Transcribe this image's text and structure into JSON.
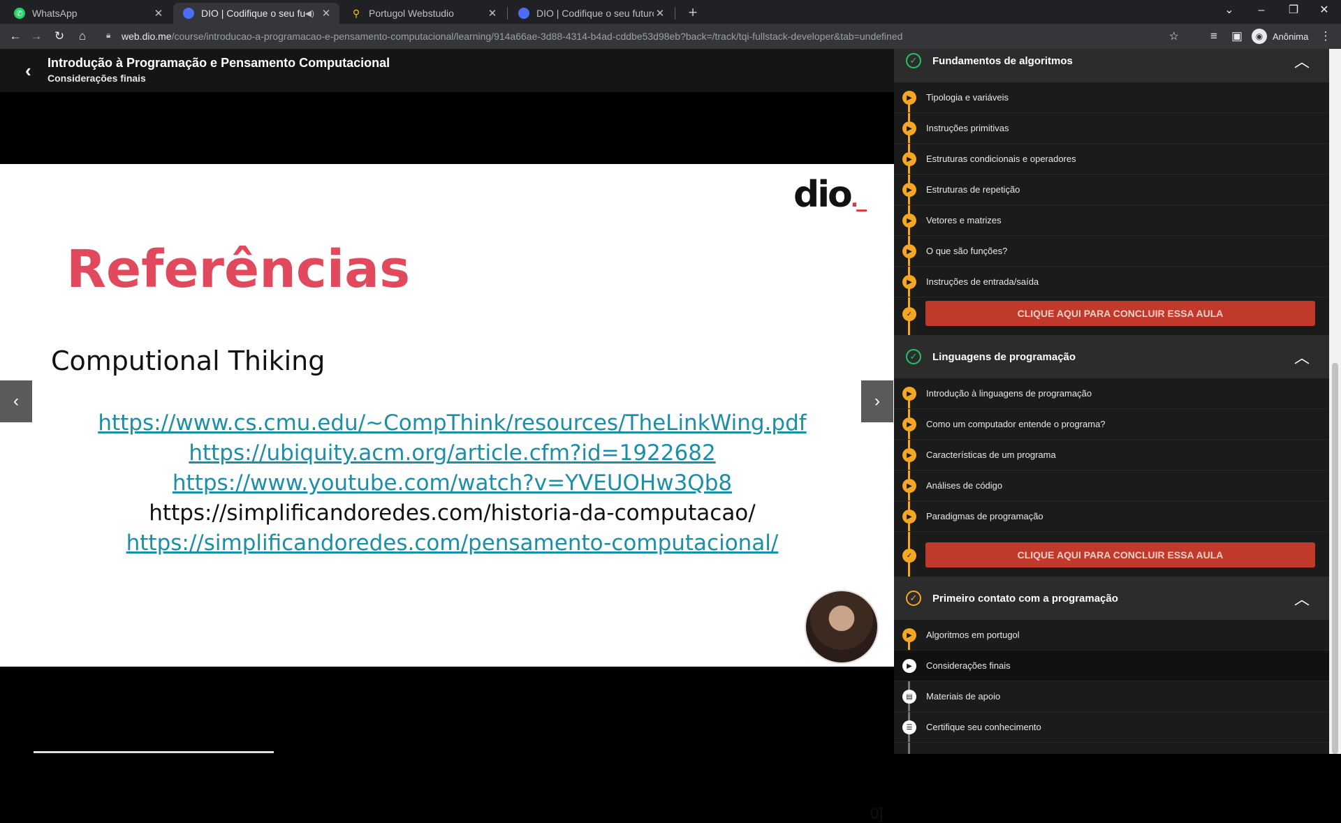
{
  "browser": {
    "tabs": [
      {
        "title": "WhatsApp",
        "favicon": "whatsapp-icon",
        "color": "#25d366"
      },
      {
        "title": "DIO | Codifique o seu futuro",
        "favicon": "dio-icon",
        "color": "#4e6cf5",
        "muted_icon": "speaker-icon"
      },
      {
        "title": "Portugol Webstudio",
        "favicon": "pin-icon",
        "color": "#f5c518"
      },
      {
        "title": "DIO | Codifique o seu futuro glol",
        "favicon": "dio-icon",
        "color": "#4e6cf5"
      }
    ],
    "url_host": "web.dio.me",
    "url_path": "/course/introducao-a-programacao-e-pensamento-computacional/learning/914a66ae-3d88-4314-b4ad-cddbe53d98eb?back=/track/tqi-fullstack-developer&tab=undefined",
    "profile_label": "Anônima"
  },
  "course": {
    "title": "Introdução à Programação e Pensamento Computacional",
    "subtitle": "Considerações finais"
  },
  "slide": {
    "logo_text": "dio",
    "logo_dot": "._",
    "heading": "Referências",
    "subheading": "Computional Thiking",
    "links": [
      "https://www.cs.cmu.edu/~CompThink/resources/TheLinkWing.pdf",
      "https://ubiquity.acm.org/article.cfm?id=1922682",
      "https://www.youtube.com/watch?v=YVEUOHw3Qb8",
      "https://simplificandoredes.com/historia-da-computacao/",
      "https://simplificandoredes.com/pensamento-computacional/"
    ],
    "bracket_text": "0]"
  },
  "sidebar": {
    "sections": [
      {
        "title": "Fundamentos de algoritmos",
        "status": "complete",
        "lessons": [
          "Tipologia e variáveis",
          "Instruções primitivas",
          "Estruturas condicionais e operadores",
          "Estruturas de repetição",
          "Vetores e matrizes",
          "O que são funções?",
          "Instruções de entrada/saída"
        ],
        "complete_button": "CLIQUE AQUI PARA CONCLUIR ESSA AULA"
      },
      {
        "title": "Linguagens de programação",
        "status": "complete",
        "lessons": [
          "Introdução à linguagens de programação",
          "Como um computador entende o programa?",
          "Características de um programa",
          "Análises de código",
          "Paradigmas de programação"
        ],
        "complete_button": "CLIQUE AQUI PARA CONCLUIR ESSA AULA"
      },
      {
        "title": "Primeiro contato com a programação",
        "status": "in-progress",
        "lessons": [
          "Algoritmos em portugol",
          "Considerações finais",
          "Materiais de apoio",
          "Certifique seu conhecimento"
        ]
      }
    ]
  },
  "colors": {
    "accent": "#f5a623",
    "complete": "#26c267",
    "button": "#c0392b",
    "link": "#1b8fa8",
    "heading": "#e04a5c"
  }
}
